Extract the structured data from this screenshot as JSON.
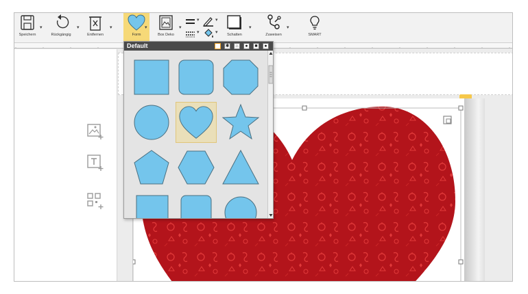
{
  "toolbar": {
    "save_label": "Speichern",
    "undo_label": "Rückgängig",
    "remove_label": "Entfernen",
    "shape_label": "Form",
    "boxdeco_label": "Box Deko",
    "shadow_label": "Schatten",
    "assign_label": "Zuweisen",
    "smart_label": "SMART"
  },
  "shape_popup": {
    "title": "Default",
    "tabs": [
      "default-tab",
      "star-tab",
      "house-tab",
      "bubble-tab",
      "square-tab",
      "circle-tab"
    ],
    "selected_shape": "heart",
    "shapes": [
      "square",
      "rounded-square",
      "octagon",
      "circle",
      "heart",
      "star",
      "pentagon",
      "hexagon",
      "triangle",
      "square-partial",
      "rounded-square-partial",
      "circle-partial"
    ]
  },
  "colors": {
    "accent_yellow": "#f6d978",
    "shape_blue": "#74c5ec",
    "heart_red": "#b3141b",
    "toolbar_bg": "#f2f2f2"
  }
}
